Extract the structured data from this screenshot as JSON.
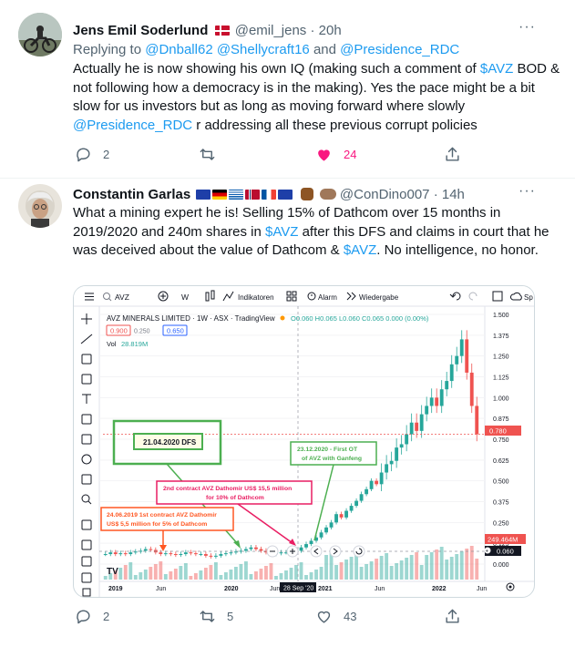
{
  "tweet1": {
    "name": "Jens Emil Soderlund",
    "handle": "@emil_jens",
    "time": "· 20h",
    "replying_to": "Replying to",
    "mentions": [
      "@Dnball62",
      "@Shellycraft16",
      "and",
      "@Presidence_RDC"
    ],
    "text_parts": [
      "Actually he is now showing his own IQ (making such a comment of ",
      "$AVZ",
      " BOD & not following how a democracy is in the making). Yes the pace might be a bit slow for us investors but as long as moving forward where slowly ",
      "@Presidence_RDC",
      " r addressing all these previous corrupt policies"
    ],
    "replies": "2",
    "retweets": "",
    "likes": "24",
    "liked_color": "#f91880"
  },
  "tweet2": {
    "name": "Constantin Garlas",
    "handle": "@ConDino007",
    "time": "· 14h",
    "text_parts": [
      "What a mining expert he is! Selling 15% of Dathcom over 15 months in 2019/2020 and 240m shares in ",
      "$AVZ",
      " after this DFS and claims in court that he was deceived about the value of Dathcom & ",
      "$AVZ",
      ". No intelligence, no honor."
    ],
    "replies": "2",
    "retweets": "5",
    "likes": "43"
  },
  "chart_toolbar": {
    "symbol": "AVZ",
    "interval": "W",
    "indicators": "Indikatoren",
    "alarm": "Alarm",
    "replay": "Wiedergabe",
    "save": "Sp"
  },
  "chart_legend": {
    "title": "AVZ MINERALS LIMITED · 1W · ASX · TradingView",
    "ohlc": "O0.060 H0.065 L0.060 C0.065 0.000 (0.00%)",
    "bid": "0.900",
    "spread": "0.250",
    "ask": "0.650",
    "vol_label": "Vol",
    "vol_value": "28.819M"
  },
  "annotations": {
    "dfs": "21.04.2020 DFS",
    "first_ot": "23.12.2020 - First OT of AVZ with Ganfeng",
    "second_contract": "2nd contract AVZ Dathomir US$ 15,5 million for 10% of Dathcom",
    "first_contract": "24.06.2019 1st contract AVZ Dathomir US$ 5,5 million for 5% of Dathcom"
  },
  "price_badges": {
    "last": "0.780",
    "volume": "249.464M",
    "low": "0.060"
  },
  "crosshair_date": "28 Sep '20",
  "chart_data": {
    "type": "candlestick",
    "title": "AVZ MINERALS LIMITED · 1W · ASX · TradingView",
    "x_ticks": [
      "2019",
      "Jun",
      "2020",
      "Jun",
      "2021",
      "Jun",
      "2022",
      "Jun"
    ],
    "y_ticks": [
      "1.500",
      "1.375",
      "1.250",
      "1.125",
      "1.000",
      "0.875",
      "0.750",
      "0.625",
      "0.500",
      "0.375",
      "0.250",
      "0.125",
      "0.000"
    ],
    "ylim": [
      0,
      1.5
    ],
    "close_series": [
      0.06,
      0.07,
      0.06,
      0.065,
      0.06,
      0.07,
      0.075,
      0.08,
      0.09,
      0.085,
      0.07,
      0.06,
      0.065,
      0.06,
      0.055,
      0.06,
      0.07,
      0.065,
      0.06,
      0.06,
      0.05,
      0.045,
      0.05,
      0.06,
      0.065,
      0.07,
      0.075,
      0.08,
      0.09,
      0.1,
      0.09,
      0.08,
      0.07,
      0.06,
      0.065,
      0.07,
      0.07,
      0.075,
      0.08,
      0.1,
      0.12,
      0.14,
      0.16,
      0.19,
      0.22,
      0.25,
      0.3,
      0.28,
      0.32,
      0.35,
      0.38,
      0.42,
      0.45,
      0.5,
      0.48,
      0.55,
      0.6,
      0.62,
      0.7,
      0.72,
      0.78,
      0.85,
      0.8,
      0.9,
      0.95,
      1.0,
      0.95,
      1.05,
      1.1,
      1.2,
      1.25,
      1.35,
      1.15,
      0.95,
      0.78
    ]
  }
}
